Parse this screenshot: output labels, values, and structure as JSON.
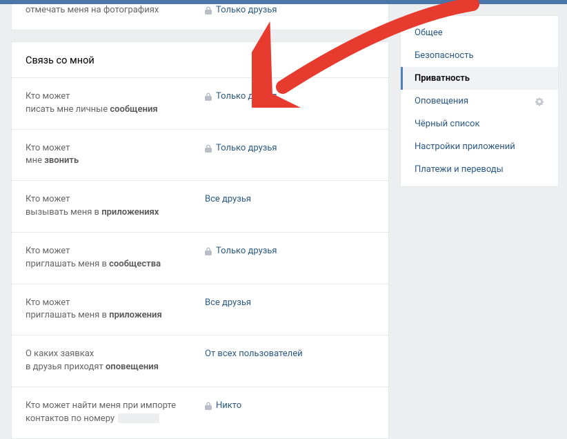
{
  "top_cut": {
    "label_line2": "отмечать меня на фотографиях",
    "value": "Только друзья",
    "locked": true
  },
  "section": {
    "title": "Связь со мной",
    "rows": [
      {
        "line1": "Кто может",
        "line2_pre": "писать мне личные ",
        "line2_bold": "сообщения",
        "value": "Только друзья",
        "locked": true
      },
      {
        "line1": "Кто может",
        "line2_pre": "мне ",
        "line2_bold": "звонить",
        "value": "Только друзья",
        "locked": true
      },
      {
        "line1": "Кто может",
        "line2_pre": "вызывать меня в ",
        "line2_bold": "приложениях",
        "value": "Все друзья",
        "locked": false
      },
      {
        "line1": "Кто может",
        "line2_pre": "приглашать меня в ",
        "line2_bold": "сообщества",
        "value": "Только друзья",
        "locked": true
      },
      {
        "line1": "Кто может",
        "line2_pre": "приглашать меня в ",
        "line2_bold": "приложения",
        "value": "Все друзья",
        "locked": false
      },
      {
        "line1": "О каких заявках",
        "line2_pre": "в друзья приходят ",
        "line2_bold": "оповещения",
        "value": "От всех пользователей",
        "locked": false
      },
      {
        "line1": "Кто может найти меня при импорте",
        "line2_pre": "контактов по номеру ",
        "line2_bold": "",
        "value": "Никто",
        "locked": true,
        "phone_redacted": true
      }
    ]
  },
  "sidebar": {
    "items": [
      {
        "label": "Общее",
        "active": false,
        "gear": false
      },
      {
        "label": "Безопасность",
        "active": false,
        "gear": false
      },
      {
        "label": "Приватность",
        "active": true,
        "gear": false
      },
      {
        "label": "Оповещения",
        "active": false,
        "gear": true
      },
      {
        "label": "Чёрный список",
        "active": false,
        "gear": false
      },
      {
        "label": "Настройки приложений",
        "active": false,
        "gear": false
      },
      {
        "label": "Платежи и переводы",
        "active": false,
        "gear": false
      }
    ]
  }
}
